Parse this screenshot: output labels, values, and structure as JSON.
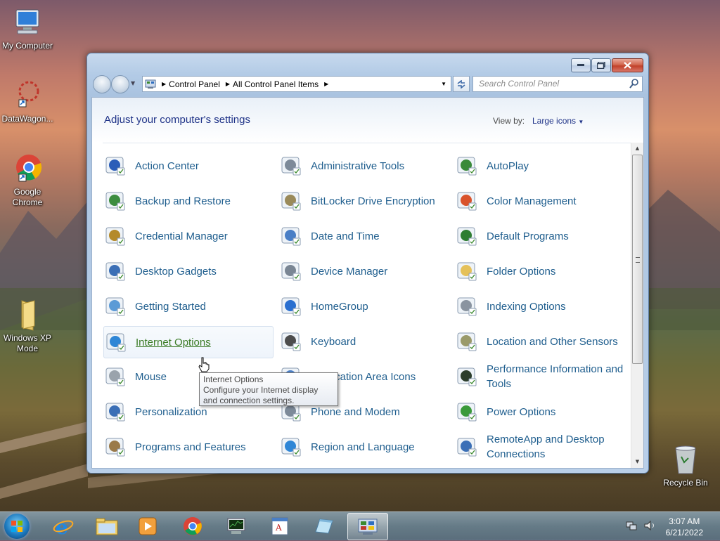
{
  "desktop": {
    "icons": [
      {
        "label": "My Computer"
      },
      {
        "label": "DataWagon..."
      },
      {
        "label": "Google Chrome"
      },
      {
        "label": "Windows XP Mode"
      },
      {
        "label": "Recycle Bin"
      }
    ]
  },
  "window": {
    "breadcrumb": [
      "Control Panel",
      "All Control Panel Items"
    ],
    "search_placeholder": "Search Control Panel",
    "heading": "Adjust your computer's settings",
    "view_by_label": "View by:",
    "view_by_value": "Large icons",
    "items": [
      {
        "label": "Action Center",
        "icon": "flag-icon"
      },
      {
        "label": "Administrative Tools",
        "icon": "admin-tools-icon"
      },
      {
        "label": "AutoPlay",
        "icon": "autoplay-icon"
      },
      {
        "label": "Backup and Restore",
        "icon": "backup-icon"
      },
      {
        "label": "BitLocker Drive Encryption",
        "icon": "bitlocker-icon"
      },
      {
        "label": "Color Management",
        "icon": "color-management-icon"
      },
      {
        "label": "Credential Manager",
        "icon": "credential-icon"
      },
      {
        "label": "Date and Time",
        "icon": "calendar-clock-icon"
      },
      {
        "label": "Default Programs",
        "icon": "default-programs-icon"
      },
      {
        "label": "Desktop Gadgets",
        "icon": "gadgets-icon"
      },
      {
        "label": "Device Manager",
        "icon": "device-manager-icon"
      },
      {
        "label": "Folder Options",
        "icon": "folder-options-icon"
      },
      {
        "label": "Getting Started",
        "icon": "getting-started-icon"
      },
      {
        "label": "HomeGroup",
        "icon": "homegroup-icon"
      },
      {
        "label": "Indexing Options",
        "icon": "indexing-icon"
      },
      {
        "label": "Internet Options",
        "icon": "internet-options-icon"
      },
      {
        "label": "Keyboard",
        "icon": "keyboard-icon"
      },
      {
        "label": "Location and Other Sensors",
        "icon": "sensors-icon"
      },
      {
        "label": "Mouse",
        "icon": "mouse-icon"
      },
      {
        "label": "Notification Area Icons",
        "icon": "notification-icon"
      },
      {
        "label": "Performance Information and Tools",
        "icon": "performance-icon"
      },
      {
        "label": "Personalization",
        "icon": "personalization-icon"
      },
      {
        "label": "Phone and Modem",
        "icon": "phone-icon"
      },
      {
        "label": "Power Options",
        "icon": "power-icon"
      },
      {
        "label": "Programs and Features",
        "icon": "programs-icon"
      },
      {
        "label": "Region and Language",
        "icon": "region-icon"
      },
      {
        "label": "RemoteApp and Desktop Connections",
        "icon": "remoteapp-icon"
      }
    ],
    "tooltip": {
      "title": "Internet Options",
      "text": "Configure your Internet display and connection settings."
    }
  },
  "taskbar": {
    "time": "3:07 AM",
    "date": "6/21/2022"
  }
}
